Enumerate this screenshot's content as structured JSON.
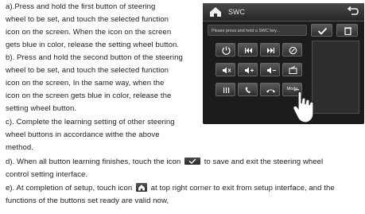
{
  "instructions": {
    "lines": [
      "a).Press and hold the first button of steering",
      "wheel to be set, and touch the selected function",
      "icon on the screen. When the icon on the screen",
      "gets blue in color, release the setting wheel button.",
      "b). Press and hold the second button of the steering",
      "wheel to be set, and touch the selected function",
      "icon on the screen, In the same way, when the",
      "icon on the screen gets blue in color, release the",
      "setting wheel button.",
      "c). Complete the learning setting of other steering",
      "wheel buttons in accordance withe the above",
      "method."
    ],
    "d_before": "d). When all button learning finishes, touch the icon",
    "d_after": "to save and exit the steering wheel",
    "d_line2": "control setting interface.",
    "e_before": "e). At completion of setup, touch icon",
    "e_after": "at top right corner to exit from setup interface, and the",
    "e_line2": "functions of the buttons set ready are valid now,"
  },
  "device": {
    "title": "SWC",
    "prompt": "Please press and hold a SWC key...",
    "mode_label": "Mode",
    "icons": {
      "home": "home-icon",
      "back": "back-arrow-icon",
      "confirm": "check-icon",
      "delete": "trash-icon",
      "hand": "hand-pointer-icon"
    },
    "colors": {
      "panel": "#1c1c1c",
      "button": "#3f3f3f",
      "text": "#e8e8e8"
    }
  }
}
